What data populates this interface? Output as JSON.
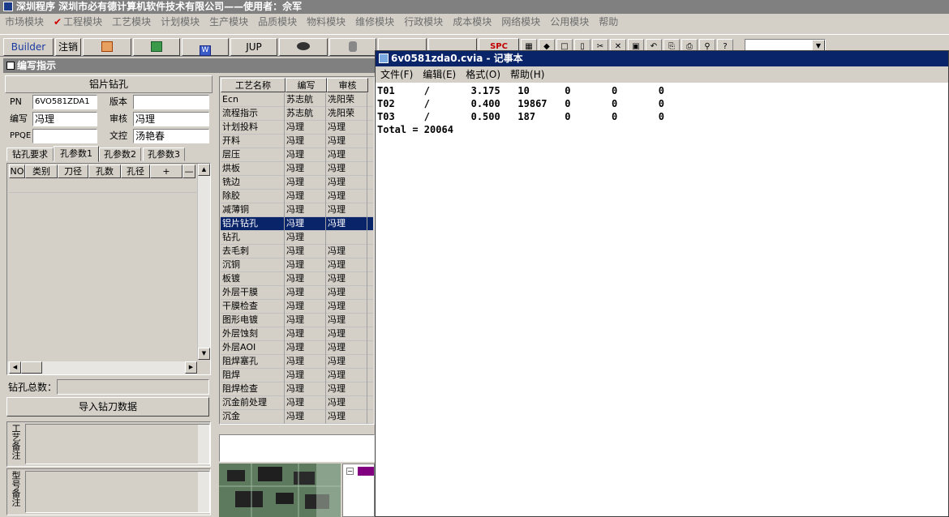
{
  "app": {
    "title": "深圳程序  深圳市必有德计算机软件技术有限公司——使用者：佘军"
  },
  "menu": {
    "items": [
      "市场模块",
      "工程模块",
      "工艺模块",
      "计划模块",
      "生产模块",
      "品质模块",
      "物料模块",
      "维修模块",
      "行政模块",
      "成本模块",
      "网络模块",
      "公用模块",
      "帮助"
    ]
  },
  "toolbar": {
    "builder_label": "Builder",
    "logout_label": "注销",
    "jup_label": "JUP",
    "spc_label": "SPC"
  },
  "panel": {
    "title": "编写指示",
    "section_title": "铝片钻孔",
    "pn_label": "PN",
    "pn_value": "6VO581ZDA1",
    "version_label": "版本",
    "version_value": "",
    "author_label": "编写",
    "author_value": "冯理",
    "reviewer_label": "审核",
    "reviewer_value": "冯理",
    "ppqe_label": "PPQE",
    "ppqe_value": "",
    "doc_control_label": "文控",
    "doc_control_value": "汤艳春",
    "tabs": [
      "钻孔要求",
      "孔参数1",
      "孔参数2",
      "孔参数3"
    ],
    "grid_headers": [
      "NO",
      "类别",
      "刀径",
      "孔数",
      "孔径",
      "+",
      "—"
    ],
    "total_label": "钻孔总数：",
    "total_value": "",
    "import_button": "导入钻刀数据",
    "process_note_label": "工艺备注",
    "model_note_label": "型号备注"
  },
  "process_table": {
    "headers": [
      "工艺名称",
      "编写",
      "审核"
    ],
    "rows": [
      {
        "name": "Ecn",
        "author": "苏志航",
        "reviewer": "冼阳荣"
      },
      {
        "name": "流程指示",
        "author": "苏志航",
        "reviewer": "冼阳荣"
      },
      {
        "name": "计划投料",
        "author": "冯理",
        "reviewer": "冯理"
      },
      {
        "name": "开料",
        "author": "冯理",
        "reviewer": "冯理"
      },
      {
        "name": "层压",
        "author": "冯理",
        "reviewer": "冯理"
      },
      {
        "name": "烘板",
        "author": "冯理",
        "reviewer": "冯理"
      },
      {
        "name": "铣边",
        "author": "冯理",
        "reviewer": "冯理"
      },
      {
        "name": "除胶",
        "author": "冯理",
        "reviewer": "冯理"
      },
      {
        "name": "减薄铜",
        "author": "冯理",
        "reviewer": "冯理"
      },
      {
        "name": "铝片钻孔",
        "author": "冯理",
        "reviewer": "冯理",
        "selected": true
      },
      {
        "name": "钻孔",
        "author": "冯理",
        "reviewer": ""
      },
      {
        "name": "去毛刺",
        "author": "冯理",
        "reviewer": "冯理"
      },
      {
        "name": "沉铜",
        "author": "冯理",
        "reviewer": "冯理"
      },
      {
        "name": "板镀",
        "author": "冯理",
        "reviewer": "冯理"
      },
      {
        "name": "外层干膜",
        "author": "冯理",
        "reviewer": "冯理"
      },
      {
        "name": "干膜检查",
        "author": "冯理",
        "reviewer": "冯理"
      },
      {
        "name": "图形电镀",
        "author": "冯理",
        "reviewer": "冯理"
      },
      {
        "name": "外层蚀刻",
        "author": "冯理",
        "reviewer": "冯理"
      },
      {
        "name": "外层AOI",
        "author": "冯理",
        "reviewer": "冯理"
      },
      {
        "name": "阻焊塞孔",
        "author": "冯理",
        "reviewer": "冯理"
      },
      {
        "name": "阻焊",
        "author": "冯理",
        "reviewer": "冯理"
      },
      {
        "name": "阻焊检查",
        "author": "冯理",
        "reviewer": "冯理"
      },
      {
        "name": "沉金前处理",
        "author": "冯理",
        "reviewer": "冯理"
      },
      {
        "name": "沉金",
        "author": "冯理",
        "reviewer": "冯理"
      }
    ]
  },
  "notepad": {
    "title": "6v0581zda0.cvia - 记事本",
    "menu": [
      "文件(F)",
      "编辑(E)",
      "格式(O)",
      "帮助(H)"
    ],
    "content": "T01     /       3.175   10      0       0       0\nT02     /       0.400   19867   0       0       0\nT03     /       0.500   187     0       0       0\nTotal = 20064"
  },
  "colors": {
    "selection": "#0a246a",
    "window_face": "#d4d0c8"
  }
}
